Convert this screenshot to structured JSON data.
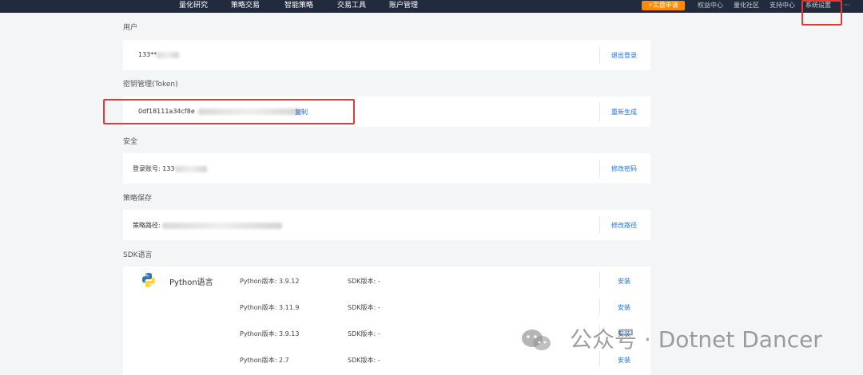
{
  "nav": {
    "items": [
      "量化研究",
      "策略交易",
      "智能策略",
      "交易工具",
      "账户管理"
    ],
    "live_button": "实盘申请",
    "right_items": [
      "权益中心",
      "量化社区",
      "支持中心",
      "系统设置"
    ],
    "more": "···"
  },
  "user": {
    "title": "用户",
    "phone": "133**",
    "logout": "退出登录"
  },
  "token": {
    "title": "密钥管理(Token)",
    "value": "0df18111a34cf8e",
    "copy": "复制",
    "regenerate": "重新生成"
  },
  "security": {
    "title": "安全",
    "account_label": "登录账号:",
    "account_value": "133",
    "change_password": "修改密码"
  },
  "strategy": {
    "title": "策略保存",
    "path_label": "策略路径:",
    "change_path": "修改路径"
  },
  "sdk": {
    "title": "SDK语言",
    "language": "Python语言",
    "rows": [
      {
        "python": "Python版本: 3.9.12",
        "sdk": "SDK版本: -",
        "action": "安装"
      },
      {
        "python": "Python版本: 3.11.9",
        "sdk": "SDK版本: -",
        "action": "安装"
      },
      {
        "python": "Python版本: 3.9.13",
        "sdk": "SDK版本: -",
        "action": "安装"
      },
      {
        "python": "Python版本: 2.7",
        "sdk": "SDK版本: -",
        "action": "安装"
      }
    ]
  },
  "watermark": {
    "text": "公众号 · Dotnet Dancer"
  },
  "colors": {
    "nav_bg": "#222b3d",
    "accent_orange": "#ff8a00",
    "link_blue": "#1a73e8",
    "highlight_red": "#e53935"
  },
  "icons": [
    "python-logo-icon",
    "wechat-icon",
    "lightning-icon"
  ]
}
